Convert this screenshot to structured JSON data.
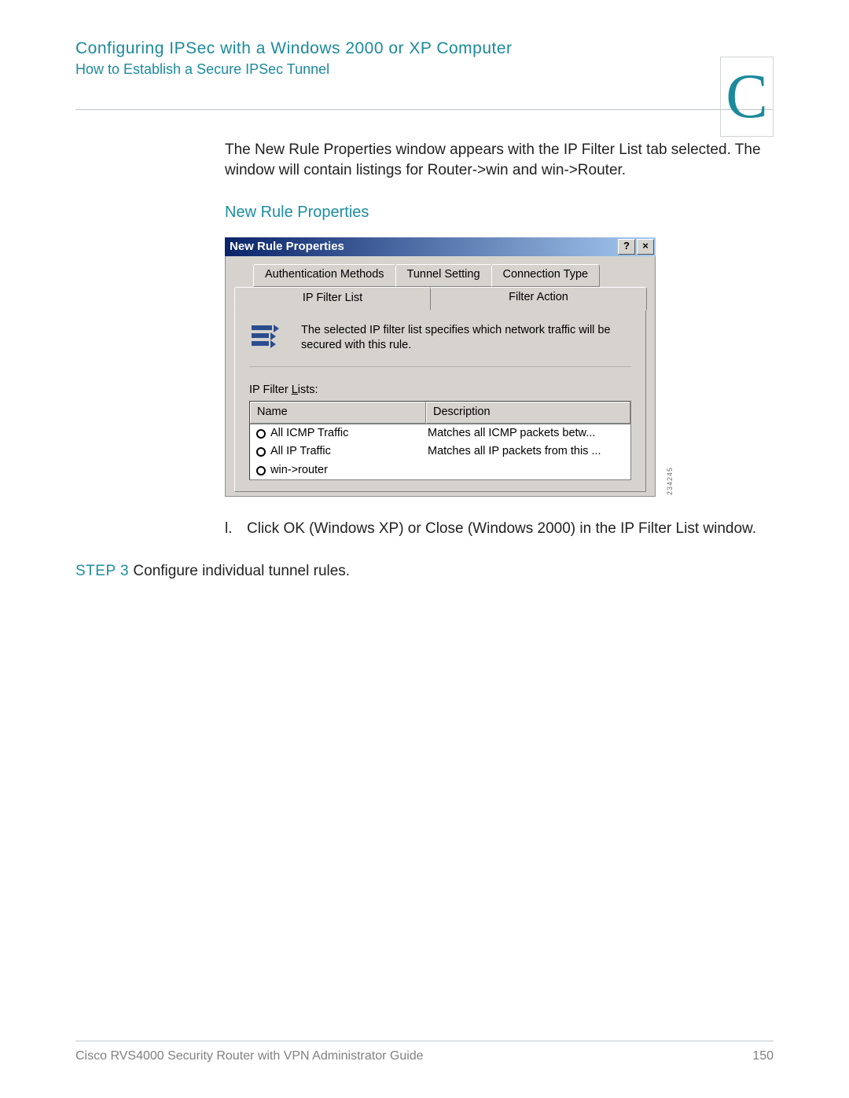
{
  "header": {
    "title": "Configuring IPSec with a Windows 2000 or XP Computer",
    "subtitle": "How to Establish a Secure IPSec Tunnel",
    "appendix_letter": "C"
  },
  "body": {
    "para1": "The New Rule Properties window appears with the IP Filter List tab selected. The window will contain listings for Router->win and win->Router.",
    "figure_caption": "New Rule Properties"
  },
  "dialog": {
    "title": "New Rule Properties",
    "help_btn": "?",
    "close_btn": "×",
    "tabs_top": {
      "auth": "Authentication Methods",
      "tunnel": "Tunnel Setting",
      "conn": "Connection Type"
    },
    "tabs_bottom": {
      "filter_list": "IP Filter List",
      "filter_action": "Filter Action"
    },
    "description": "The selected IP filter list specifies which network traffic will be secured with this rule.",
    "list_label_prefix": "IP Filter ",
    "list_label_u": "L",
    "list_label_suffix": "ists:",
    "columns": {
      "name": "Name",
      "desc": "Description"
    },
    "rows": [
      {
        "name": "All ICMP Traffic",
        "desc": "Matches all ICMP packets betw..."
      },
      {
        "name": "All IP Traffic",
        "desc": "Matches all IP packets from this ..."
      },
      {
        "name": "win->router",
        "desc": ""
      }
    ],
    "figure_id": "234245"
  },
  "steps": {
    "item_l_marker": "l.",
    "item_l_text": "Click OK (Windows XP) or Close (Windows 2000) in the IP Filter List window.",
    "step3_label": "STEP 3",
    "step3_text": " Configure individual tunnel rules."
  },
  "footer": {
    "guide": "Cisco RVS4000 Security Router with VPN Administrator Guide",
    "page": "150"
  }
}
